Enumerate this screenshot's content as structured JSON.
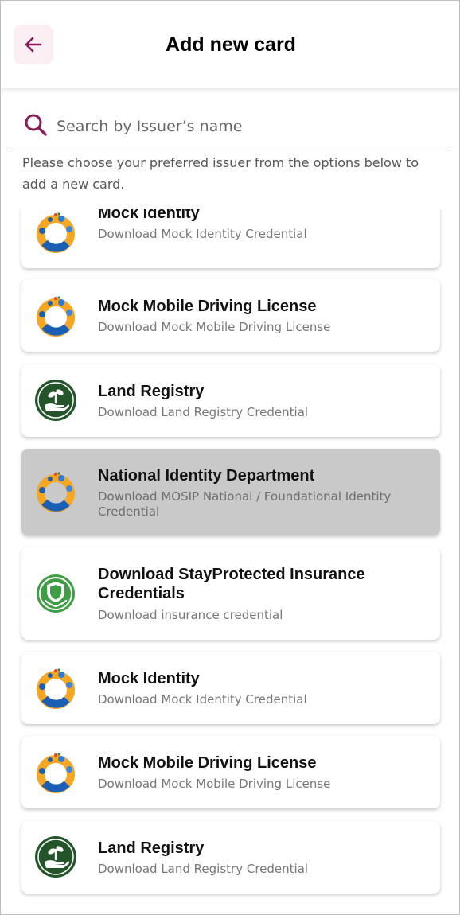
{
  "header": {
    "title": "Add new card",
    "back_icon": "arrow-left-icon",
    "accent_color": "#8a1b57",
    "back_bg": "#fbeff4"
  },
  "search": {
    "placeholder": "Search by Issuer’s name",
    "icon": "search-icon",
    "value": ""
  },
  "instruction": "Please choose your preferred issuer from the options below to add a new card.",
  "issuers": [
    {
      "title": "Mock Identity",
      "subtitle": "Download Mock Identity Credential",
      "logo": "mosip-ring-logo",
      "highlighted": false
    },
    {
      "title": "Mock Mobile Driving License",
      "subtitle": "Download Mock Mobile Driving License",
      "logo": "mosip-ring-logo",
      "highlighted": false
    },
    {
      "title": "Land Registry",
      "subtitle": "Download Land Registry Credential",
      "logo": "land-registry-logo",
      "highlighted": false
    },
    {
      "title": "National Identity Department",
      "subtitle": "Download MOSIP National / Foundational Identity Credential",
      "logo": "mosip-ring-logo",
      "highlighted": true
    },
    {
      "title": "Download StayProtected Insurance Credentials",
      "subtitle": "Download insurance credential",
      "logo": "insurance-shield-logo",
      "highlighted": false
    },
    {
      "title": "Mock Identity",
      "subtitle": "Download Mock Identity Credential",
      "logo": "mosip-ring-logo",
      "highlighted": false
    },
    {
      "title": "Mock Mobile Driving License",
      "subtitle": "Download Mock Mobile Driving License",
      "logo": "mosip-ring-logo",
      "highlighted": false
    },
    {
      "title": "Land Registry",
      "subtitle": "Download Land Registry Credential",
      "logo": "land-registry-logo",
      "highlighted": false
    }
  ]
}
